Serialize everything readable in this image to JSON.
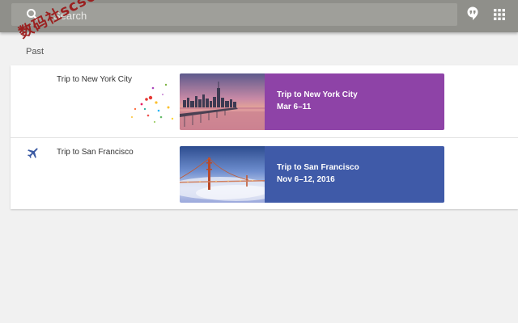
{
  "search": {
    "placeholder": "Search"
  },
  "section": {
    "label": "Past"
  },
  "trips": [
    {
      "name": "Trip to New York City",
      "tile_title": "Trip to New York City",
      "tile_dates": "Mar 6–11",
      "tile_color": "#8e43a7"
    },
    {
      "name": "Trip to San Francisco",
      "tile_title": "Trip to San Francisco",
      "tile_dates": "Nov 6–12, 2016",
      "tile_color": "#3f5aa8"
    }
  ],
  "watermark": {
    "text": "数码社scs66"
  },
  "icons": {
    "search": "search-icon",
    "hangouts": "hangouts-icon",
    "apps": "apps-grid-icon",
    "plane": "airplane-icon"
  },
  "colors": {
    "topbar": "#8f8f8a",
    "background": "#f1f1f1",
    "plane": "#3b5aa3"
  }
}
